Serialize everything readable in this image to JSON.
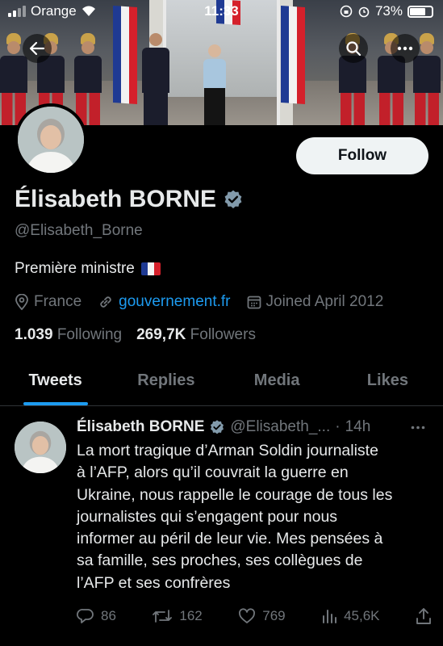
{
  "status_bar": {
    "carrier": "Orange",
    "time": "11:33",
    "battery": "73%",
    "battery_level": 0.73
  },
  "profile": {
    "follow_label": "Follow",
    "name": "Élisabeth BORNE",
    "handle": "@Elisabeth_Borne",
    "bio": "Première ministre",
    "location": "France",
    "website": "gouvernement.fr",
    "joined": "Joined April 2012",
    "following_count": "1.039",
    "following_label": "Following",
    "followers_count": "269,7K",
    "followers_label": "Followers"
  },
  "tabs": [
    {
      "label": "Tweets",
      "active": true
    },
    {
      "label": "Replies",
      "active": false
    },
    {
      "label": "Media",
      "active": false
    },
    {
      "label": "Likes",
      "active": false
    }
  ],
  "tweet": {
    "author": "Élisabeth BORNE",
    "handle": "@Elisabeth_...",
    "separator": "·",
    "time": "14h",
    "text": "La mort tragique d’Arman Soldin journaliste\nà l’AFP, alors qu’il couvrait la guerre en\nUkraine, nous rappelle le courage de tous les\njournalistes qui s’engagent pour nous\ninformer au péril de leur vie. Mes pensées à\nsa famille, ses proches, ses collègues de\nl’AFP et ses confrères",
    "replies": "86",
    "retweets": "162",
    "likes": "769",
    "views": "45,6K"
  },
  "colors": {
    "accent": "#1d9bf0",
    "verified_badge": "#829aab",
    "text_primary": "#e7e9ea",
    "text_secondary": "#71767b",
    "background": "#000000"
  },
  "icons": [
    "back-arrow-icon",
    "search-icon",
    "more-icon",
    "verified-icon",
    "location-icon",
    "link-icon",
    "calendar-icon",
    "reply-icon",
    "retweet-icon",
    "like-icon",
    "views-icon",
    "share-icon"
  ]
}
